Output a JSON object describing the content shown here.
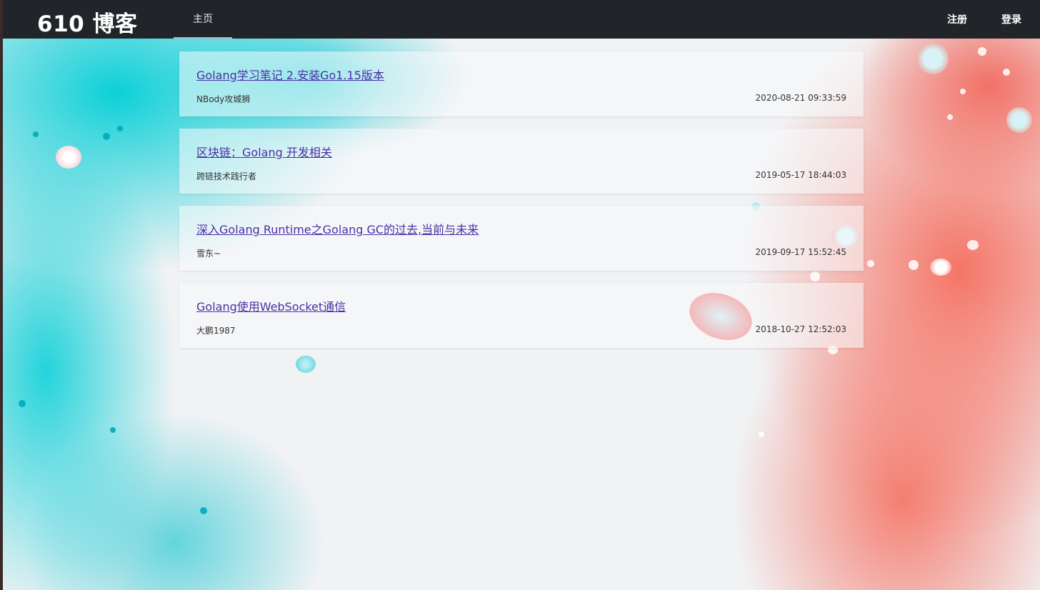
{
  "navbar": {
    "brand": "610 博客",
    "home": "主页",
    "register": "注册",
    "login": "登录"
  },
  "posts": [
    {
      "title": "Golang学习笔记 2.安装Go1.15版本",
      "author": "NBody攻城狮",
      "date": "2020-08-21 09:33:59"
    },
    {
      "title": "区块链：Golang 开发相关",
      "author": "跨链技术践行者",
      "date": "2019-05-17 18:44:03"
    },
    {
      "title": "深入Golang Runtime之Golang GC的过去,当前与未来",
      "author": "雪东~",
      "date": "2019-09-17 15:52:45"
    },
    {
      "title": "Golang使用WebSocket通信",
      "author": "大鹏1987",
      "date": "2018-10-27 12:52:03"
    }
  ],
  "colors": {
    "navbar_bg": "#212529",
    "link": "#4b2fa6",
    "teal": "#00ced6",
    "coral": "#f56e5f"
  }
}
